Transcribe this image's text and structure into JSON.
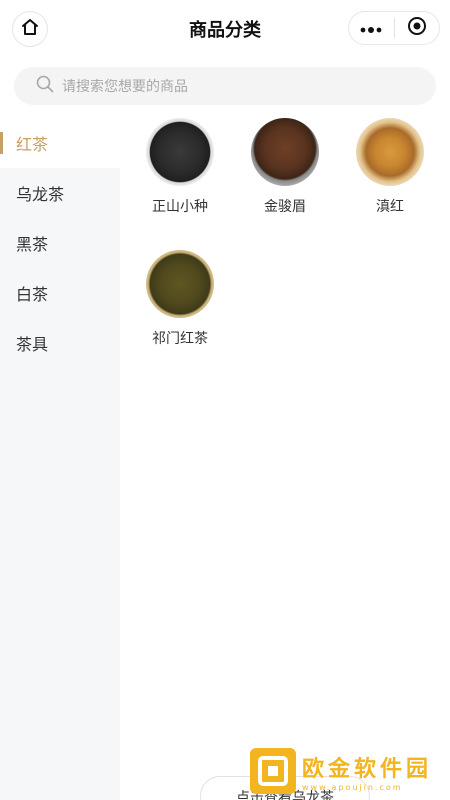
{
  "nav": {
    "title": "商品分类"
  },
  "search": {
    "placeholder": "请搜索您想要的商品"
  },
  "sidebar": {
    "items": [
      {
        "label": "红茶",
        "active": true
      },
      {
        "label": "乌龙茶",
        "active": false
      },
      {
        "label": "黑茶",
        "active": false
      },
      {
        "label": "白茶",
        "active": false
      },
      {
        "label": "茶具",
        "active": false
      }
    ]
  },
  "products": [
    {
      "name": "正山小种"
    },
    {
      "name": "金骏眉"
    },
    {
      "name": "滇红"
    },
    {
      "name": "祁门红茶"
    }
  ],
  "bottom": {
    "label": "点击查看乌龙茶"
  },
  "watermark": {
    "title": "欧金软件园",
    "url": "www.apoujin.com"
  },
  "colors": {
    "accent": "#c9a063",
    "sidebar_bg": "#f6f7f9",
    "watermark": "#f2b51f"
  }
}
